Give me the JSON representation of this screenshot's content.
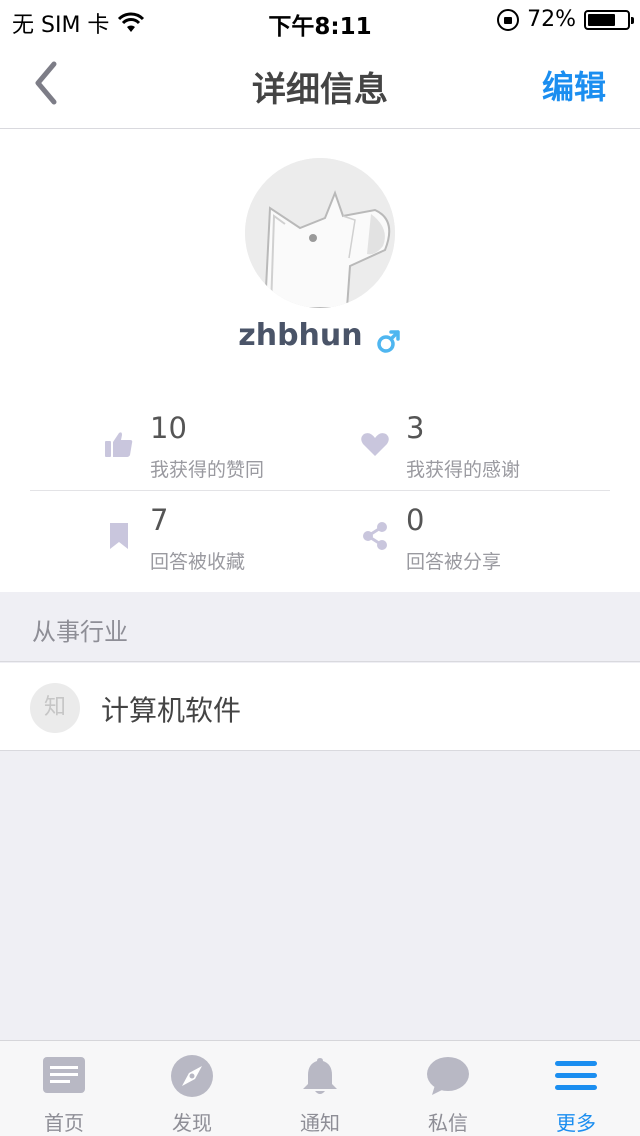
{
  "status_bar": {
    "carrier": "无 SIM 卡",
    "time": "下午8:11",
    "battery": "72%",
    "battery_level": 0.72
  },
  "nav": {
    "title": "详细信息",
    "edit": "编辑",
    "back_icon": "chevron-left-icon"
  },
  "profile": {
    "username": "zhbhun",
    "gender_icon": "male-icon",
    "stats": {
      "likes": {
        "value": "10",
        "label": "我获得的赞同",
        "icon": "thumbs-up-icon"
      },
      "thanks": {
        "value": "3",
        "label": "我获得的感谢",
        "icon": "heart-icon"
      },
      "collected": {
        "value": "7",
        "label": "回答被收藏",
        "icon": "bookmark-icon"
      },
      "shared": {
        "value": "0",
        "label": "回答被分享",
        "icon": "share-icon"
      }
    }
  },
  "industry": {
    "header": "从事行业",
    "badge": "知",
    "value": "计算机软件"
  },
  "tabs": [
    {
      "label": "首页",
      "icon": "home-feed-icon"
    },
    {
      "label": "发现",
      "icon": "compass-icon"
    },
    {
      "label": "通知",
      "icon": "bell-icon"
    },
    {
      "label": "私信",
      "icon": "chat-bubble-icon"
    },
    {
      "label": "更多",
      "icon": "menu-icon",
      "active": true
    }
  ],
  "colors": {
    "accent": "#1b8ef0",
    "icon_gray": "#b8b8c4",
    "stat_icon": "#c9c6dd"
  }
}
